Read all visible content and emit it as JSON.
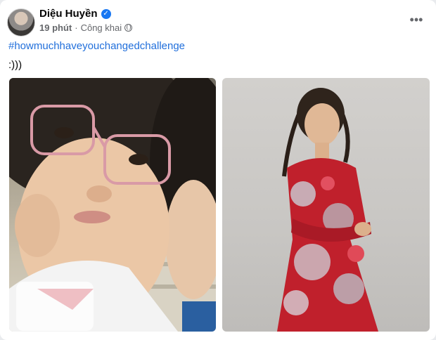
{
  "post": {
    "author": "Diệu Huyền",
    "time": "19 phút",
    "separator": "·",
    "visibility": "Công khai",
    "hashtag": "#howmuchhaveyouchangedchallenge",
    "text": ":)))"
  },
  "icons": {
    "verified": "verified-badge-icon",
    "visibility": "globe-icon",
    "more": "more-options-icon"
  },
  "colors": {
    "link": "#216fdb",
    "verified": "#1877f2",
    "meta": "#65676b"
  }
}
